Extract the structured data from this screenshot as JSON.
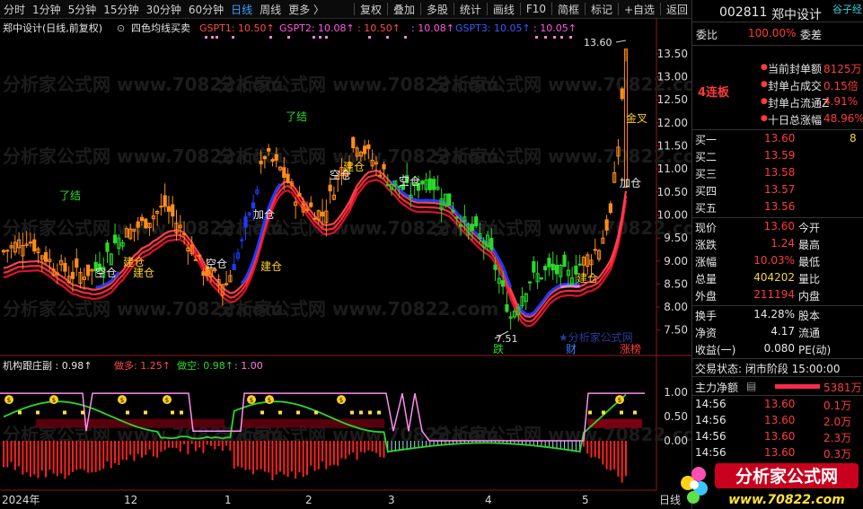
{
  "toolbar": {
    "items": [
      "分时",
      "1分钟",
      "5分钟",
      "15分钟",
      "30分钟",
      "60分钟",
      "日线",
      "周线",
      "更多 〉"
    ],
    "active_index": 6,
    "tools": [
      "复权",
      "叠加",
      "多股",
      "统计",
      "画线",
      "F10",
      "简框",
      "标记",
      "+自选",
      "返回"
    ]
  },
  "main_header": {
    "stock": "郑中设计(日线,前复权)",
    "indicator": "四色均线买卖",
    "gspt1": "GSPT1: 10.50↑",
    "gspt2": "GSPT2: 10.08↑",
    "v1": ": 10.50↑",
    "v2": ": 10.08↑",
    "gspt3": "GSPT3: 10.05↑",
    "v3": ": 10.05↑"
  },
  "chart_data": [
    {
      "type": "candlestick",
      "y_ticks": [
        "13.50",
        "13.00",
        "12.50",
        "12.00",
        "11.50",
        "11.00",
        "10.50",
        "10.00",
        "9.50",
        "9.00",
        "8.50",
        "8.00",
        "7.50"
      ],
      "ylim": [
        7.3,
        13.75
      ],
      "annotations": [
        "13.60",
        "7.51",
        "了结",
        "了结",
        "建仓",
        "空仓",
        "建仓",
        "空仓",
        "加仓",
        "建仓",
        "空仓",
        "建仓",
        "加仓",
        "建仓",
        "金叉",
        "跌",
        "财",
        "涨榜",
        "★分析家公式网",
        "空仓"
      ]
    },
    {
      "type": "line",
      "header": "机构跟庄副 : 0.98↑",
      "series_labels": [
        "做多: 1.25↑",
        "做空: 0.98↑",
        ": 1.00"
      ],
      "y_ticks": [
        "1.00",
        "0.50",
        "0.00"
      ]
    }
  ],
  "x_labels": [
    "2024年",
    "12",
    "1",
    "2",
    "3",
    "4",
    "5",
    "日线"
  ],
  "watermark": "分析家公式网 www.70822.com",
  "right_panel": {
    "code": "002811",
    "name": "郑中设计",
    "tag": "谷子经",
    "weibi_label": "委比",
    "weibi_value": "100.00%",
    "weicha_label": "委差",
    "seal_items": [
      {
        "label": "当前封单额",
        "value": "8125万"
      },
      {
        "label": "封单占成交",
        "value": "0.15倍"
      },
      {
        "label": "封单占流通Z",
        "value": "4.91%"
      },
      {
        "label": "十日总涨幅",
        "value": "48.96%"
      }
    ],
    "streak": "4连板",
    "bids": [
      {
        "label": "买一",
        "price": "13.60",
        "vol": "8"
      },
      {
        "label": "买二",
        "price": "13.59",
        "vol": ""
      },
      {
        "label": "买三",
        "price": "13.58",
        "vol": ""
      },
      {
        "label": "买四",
        "price": "13.57",
        "vol": ""
      },
      {
        "label": "买五",
        "price": "13.56",
        "vol": ""
      }
    ],
    "stats": [
      {
        "l1": "现价",
        "v1": "13.60",
        "l2": "今开"
      },
      {
        "l1": "涨跌",
        "v1": "1.24",
        "l2": "最高"
      },
      {
        "l1": "涨幅",
        "v1": "10.03%",
        "l2": "最低"
      },
      {
        "l1": "总量",
        "v1": "404202",
        "l2": "量比"
      },
      {
        "l1": "外盘",
        "v1": "211194",
        "l2": "内盘"
      }
    ],
    "stats2": [
      {
        "l1": "换手",
        "v1": "14.28%",
        "l2": "股本"
      },
      {
        "l1": "净资",
        "v1": "4.17",
        "l2": "流通"
      },
      {
        "l1": "收益(一)",
        "v1": "0.080",
        "l2": "PE(动)"
      }
    ],
    "trade_status": "交易状态: 闭市阶段 15:00:00",
    "main_net_label": "主力净额",
    "main_net_value": "5381万",
    "ticks": [
      {
        "time": "14:56",
        "price": "13.60",
        "vol": "0.1万"
      },
      {
        "time": "14:56",
        "price": "13.60",
        "vol": "2.0万"
      },
      {
        "time": "14:56",
        "price": "13.60",
        "vol": "2.3万"
      },
      {
        "time": "14:56",
        "price": "13.60",
        "vol": "0.3万"
      }
    ],
    "logo_text": "分析家公式网",
    "logo_url": "www.70822.com"
  },
  "colors": {
    "up": "#ff3b3b",
    "down": "#2bd82b",
    "orange": "#ff8c1a",
    "blue": "#1f3cff",
    "pink": "#ff7de0",
    "accent": "#3aa0ff"
  }
}
